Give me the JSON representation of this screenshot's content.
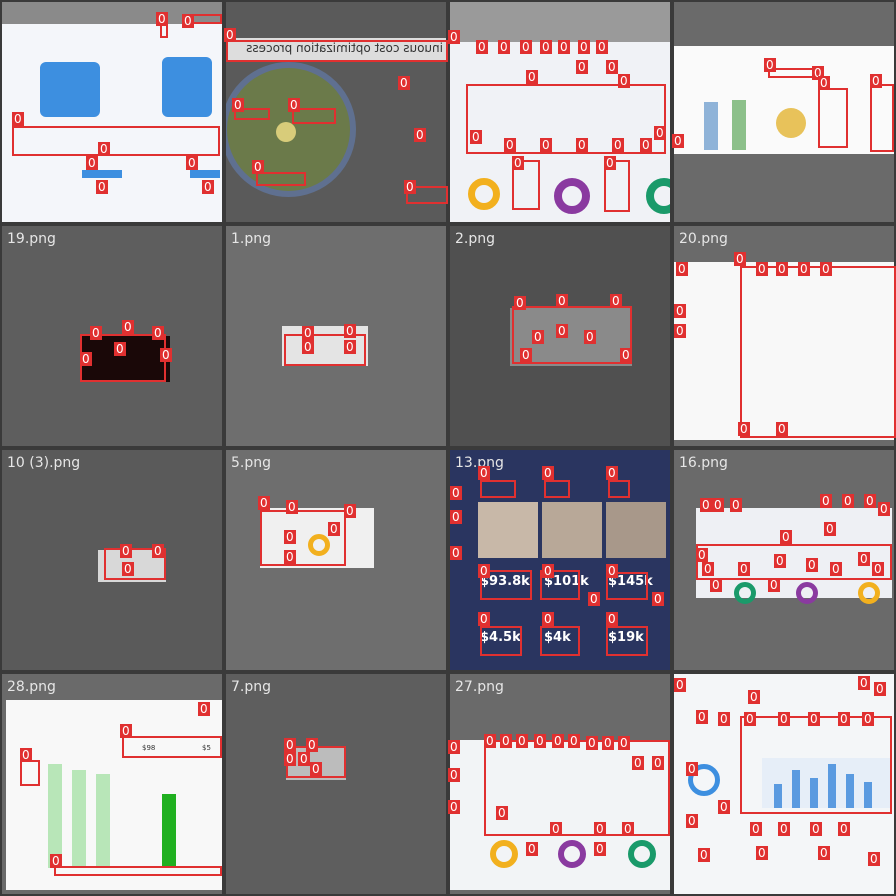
{
  "badge_label": "0",
  "tiles": [
    {
      "name": ""
    },
    {
      "name": ""
    },
    {
      "name": ""
    },
    {
      "name": ""
    },
    {
      "name": "19.png"
    },
    {
      "name": "1.png"
    },
    {
      "name": "2.png"
    },
    {
      "name": "20.png"
    },
    {
      "name": "10 (3).png"
    },
    {
      "name": "5.png"
    },
    {
      "name": "13.png"
    },
    {
      "name": "16.png"
    },
    {
      "name": "28.png"
    },
    {
      "name": "7.png"
    },
    {
      "name": "27.png"
    },
    {
      "name": ""
    }
  ],
  "tile2_heading": "inuous cost optimization process",
  "tile10_values": [
    "$93.8k",
    "$101k",
    "$145k",
    "$4.5k",
    "$4k",
    "$19k"
  ],
  "tile12_values": [
    "$98",
    "$5"
  ],
  "colors": {
    "annotation": "#e03030",
    "tile_bg": "#6a6a6a",
    "grid_bg": "#3a3a3a"
  }
}
